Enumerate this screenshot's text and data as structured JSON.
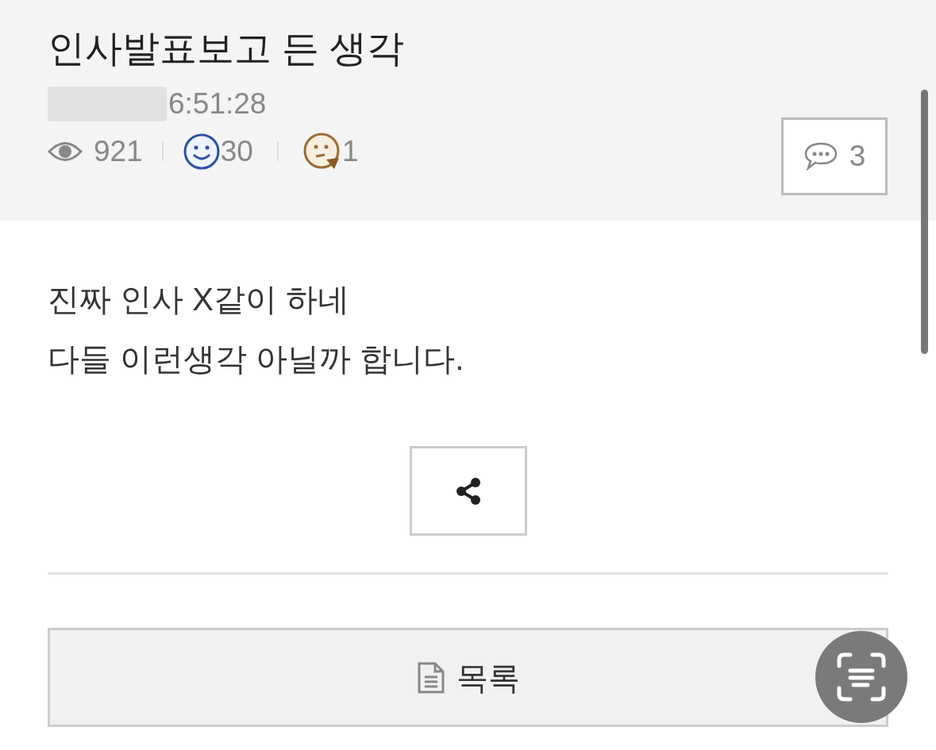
{
  "post": {
    "title": "인사발표보고 든 생각",
    "time": "6:51:28",
    "views": "921",
    "likes": "30",
    "dislikes": "1",
    "comments": "3"
  },
  "body": [
    "진짜 인사 X같이 하네",
    "다들 이런생각 아닐까 합니다."
  ],
  "list_button": "목록"
}
